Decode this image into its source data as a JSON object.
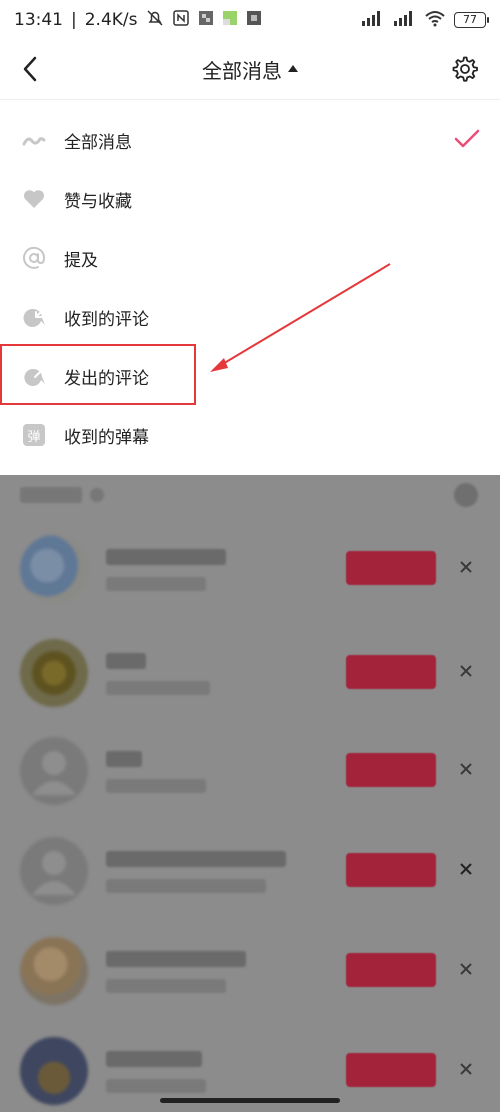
{
  "status_bar": {
    "time": "13:41",
    "separator": "|",
    "speed": "2.4K/s",
    "battery": "77"
  },
  "header": {
    "title": "全部消息"
  },
  "menu": {
    "items": [
      {
        "label": "全部消息",
        "icon": "all-messages-icon",
        "selected": true
      },
      {
        "label": "赞与收藏",
        "icon": "heart-icon",
        "selected": false
      },
      {
        "label": "提及",
        "icon": "at-icon",
        "selected": false
      },
      {
        "label": "收到的评论",
        "icon": "received-comment-icon",
        "selected": false
      },
      {
        "label": "发出的评论",
        "icon": "sent-comment-icon",
        "selected": false
      },
      {
        "label": "收到的弹幕",
        "icon": "danmaku-icon",
        "selected": false
      }
    ],
    "danmaku_glyph": "弹"
  },
  "colors": {
    "accent": "#e94e77",
    "annotation_red": "#e5383b",
    "overlay": "#8c8c8c"
  }
}
